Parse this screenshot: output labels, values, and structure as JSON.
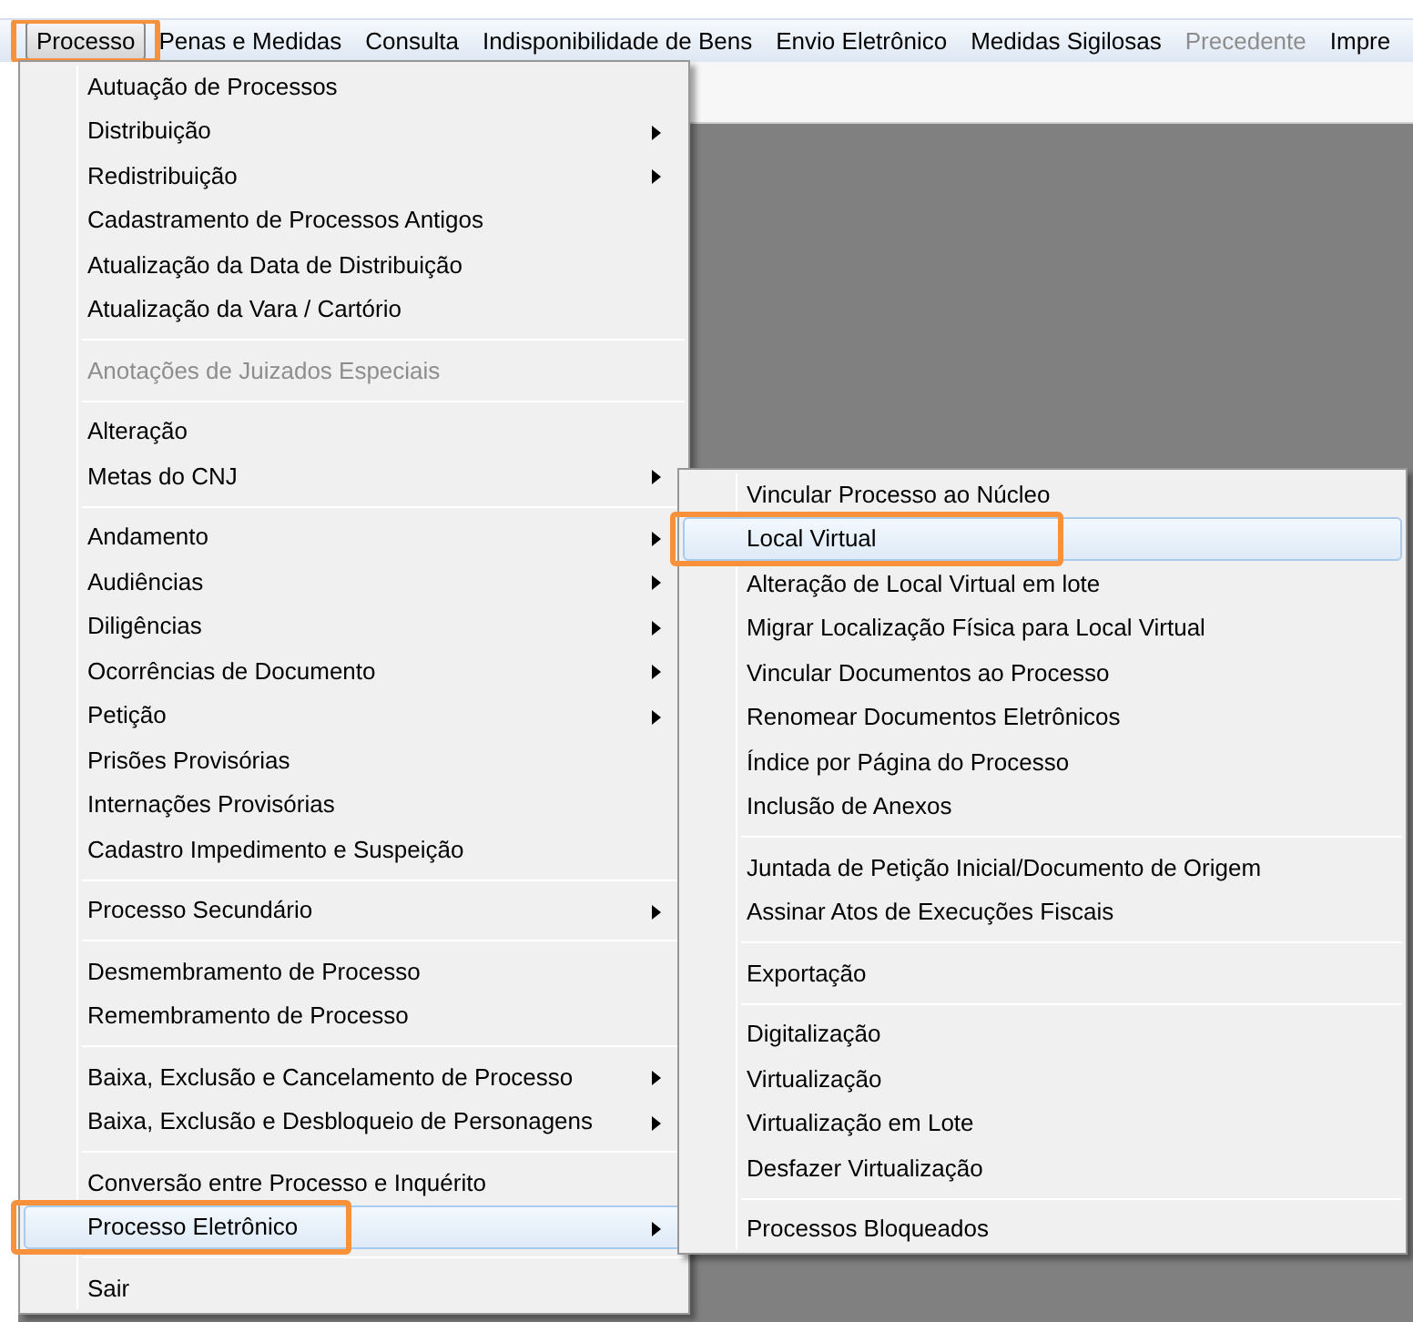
{
  "menubar": [
    {
      "label": "Processo",
      "selected": true,
      "disabled": false,
      "callout": true
    },
    {
      "label": "Penas e Medidas",
      "selected": false,
      "disabled": false,
      "callout": false
    },
    {
      "label": "Consulta",
      "selected": false,
      "disabled": false,
      "callout": false
    },
    {
      "label": "Indisponibilidade de Bens",
      "selected": false,
      "disabled": false,
      "callout": false
    },
    {
      "label": "Envio Eletrônico",
      "selected": false,
      "disabled": false,
      "callout": false
    },
    {
      "label": "Medidas Sigilosas",
      "selected": false,
      "disabled": false,
      "callout": false
    },
    {
      "label": "Precedente",
      "selected": false,
      "disabled": true,
      "callout": false
    },
    {
      "label": "Impre",
      "selected": false,
      "disabled": false,
      "callout": false
    }
  ],
  "menu": {
    "groups": [
      [
        {
          "label": "Autuação de Processos",
          "submenu": false,
          "disabled": false,
          "selected": false,
          "callout": false
        },
        {
          "label": "Distribuição",
          "submenu": true,
          "disabled": false,
          "selected": false,
          "callout": false
        },
        {
          "label": "Redistribuição",
          "submenu": true,
          "disabled": false,
          "selected": false,
          "callout": false
        },
        {
          "label": "Cadastramento de Processos Antigos",
          "submenu": false,
          "disabled": false,
          "selected": false,
          "callout": false
        },
        {
          "label": "Atualização da Data de Distribuição",
          "submenu": false,
          "disabled": false,
          "selected": false,
          "callout": false
        },
        {
          "label": "Atualização da Vara / Cartório",
          "submenu": false,
          "disabled": false,
          "selected": false,
          "callout": false
        }
      ],
      [
        {
          "label": "Anotações de Juizados Especiais",
          "submenu": false,
          "disabled": true,
          "selected": false,
          "callout": false
        }
      ],
      [
        {
          "label": "Alteração",
          "submenu": false,
          "disabled": false,
          "selected": false,
          "callout": false
        },
        {
          "label": "Metas do CNJ",
          "submenu": true,
          "disabled": false,
          "selected": false,
          "callout": false
        }
      ],
      [
        {
          "label": "Andamento",
          "submenu": true,
          "disabled": false,
          "selected": false,
          "callout": false
        },
        {
          "label": "Audiências",
          "submenu": true,
          "disabled": false,
          "selected": false,
          "callout": false
        },
        {
          "label": "Diligências",
          "submenu": true,
          "disabled": false,
          "selected": false,
          "callout": false
        },
        {
          "label": "Ocorrências de Documento",
          "submenu": true,
          "disabled": false,
          "selected": false,
          "callout": false
        },
        {
          "label": "Petição",
          "submenu": true,
          "disabled": false,
          "selected": false,
          "callout": false
        },
        {
          "label": "Prisões Provisórias",
          "submenu": false,
          "disabled": false,
          "selected": false,
          "callout": false
        },
        {
          "label": "Internações Provisórias",
          "submenu": false,
          "disabled": false,
          "selected": false,
          "callout": false
        },
        {
          "label": "Cadastro Impedimento e Suspeição",
          "submenu": false,
          "disabled": false,
          "selected": false,
          "callout": false
        }
      ],
      [
        {
          "label": "Processo Secundário",
          "submenu": true,
          "disabled": false,
          "selected": false,
          "callout": false
        }
      ],
      [
        {
          "label": "Desmembramento de Processo",
          "submenu": false,
          "disabled": false,
          "selected": false,
          "callout": false
        },
        {
          "label": "Remembramento de Processo",
          "submenu": false,
          "disabled": false,
          "selected": false,
          "callout": false
        }
      ],
      [
        {
          "label": "Baixa, Exclusão e Cancelamento de Processo",
          "submenu": true,
          "disabled": false,
          "selected": false,
          "callout": false
        },
        {
          "label": "Baixa, Exclusão e Desbloqueio de Personagens",
          "submenu": true,
          "disabled": false,
          "selected": false,
          "callout": false
        }
      ],
      [
        {
          "label": "Conversão entre Processo e Inquérito",
          "submenu": false,
          "disabled": false,
          "selected": false,
          "callout": false
        },
        {
          "label": "Processo Eletrônico",
          "submenu": true,
          "disabled": false,
          "selected": true,
          "callout": true
        }
      ],
      [
        {
          "label": "Sair",
          "submenu": false,
          "disabled": false,
          "selected": false,
          "callout": false
        }
      ]
    ]
  },
  "submenu": {
    "groups": [
      [
        {
          "label": "Vincular Processo ao Núcleo",
          "submenu": false,
          "disabled": false,
          "selected": false,
          "callout": false
        },
        {
          "label": "Local Virtual",
          "submenu": false,
          "disabled": false,
          "selected": true,
          "callout": true
        },
        {
          "label": "Alteração de Local Virtual em lote",
          "submenu": false,
          "disabled": false,
          "selected": false,
          "callout": false
        },
        {
          "label": "Migrar Localização Física para Local Virtual",
          "submenu": false,
          "disabled": false,
          "selected": false,
          "callout": false
        },
        {
          "label": "Vincular Documentos ao Processo",
          "submenu": false,
          "disabled": false,
          "selected": false,
          "callout": false
        },
        {
          "label": "Renomear Documentos Eletrônicos",
          "submenu": false,
          "disabled": false,
          "selected": false,
          "callout": false
        },
        {
          "label": "Índice por Página do Processo",
          "submenu": false,
          "disabled": false,
          "selected": false,
          "callout": false
        },
        {
          "label": "Inclusão de Anexos",
          "submenu": false,
          "disabled": false,
          "selected": false,
          "callout": false
        }
      ],
      [
        {
          "label": "Juntada de Petição Inicial/Documento de Origem",
          "submenu": false,
          "disabled": false,
          "selected": false,
          "callout": false
        },
        {
          "label": "Assinar Atos de Execuções Fiscais",
          "submenu": false,
          "disabled": false,
          "selected": false,
          "callout": false
        }
      ],
      [
        {
          "label": "Exportação",
          "submenu": false,
          "disabled": false,
          "selected": false,
          "callout": false
        }
      ],
      [
        {
          "label": "Digitalização",
          "submenu": false,
          "disabled": false,
          "selected": false,
          "callout": false
        },
        {
          "label": "Virtualização",
          "submenu": false,
          "disabled": false,
          "selected": false,
          "callout": false
        },
        {
          "label": "Virtualização em Lote",
          "submenu": false,
          "disabled": false,
          "selected": false,
          "callout": false
        },
        {
          "label": "Desfazer Virtualização",
          "submenu": false,
          "disabled": false,
          "selected": false,
          "callout": false
        }
      ],
      [
        {
          "label": "Processos Bloqueados",
          "submenu": false,
          "disabled": false,
          "selected": false,
          "callout": false
        }
      ]
    ]
  }
}
